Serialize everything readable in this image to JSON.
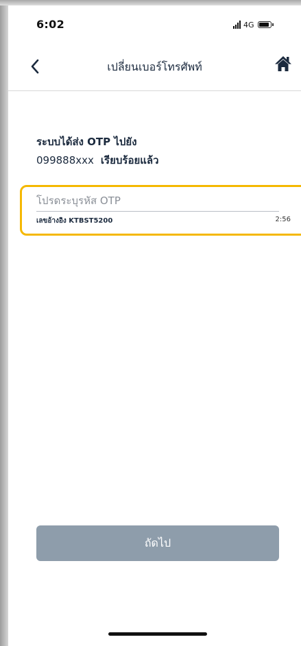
{
  "status_bar": {
    "time": "6:02",
    "network": "4G"
  },
  "header": {
    "title": "เปลี่ยนเบอร์โทรศัพท์"
  },
  "otp": {
    "line1": "ระบบได้ส่ง OTP ไปยัง",
    "phone": "099888xxx",
    "sent_status": "เรียบร้อยแล้ว",
    "placeholder": "โปรดระบุรหัส OTP",
    "value": "",
    "reference": "เลขอ้างอิง KTBST5200",
    "countdown": "2:56"
  },
  "actions": {
    "next_label": "ถัดไป"
  },
  "colors": {
    "highlight": "#f5b800",
    "button": "#8e9dab",
    "text": "#1b2a3e"
  },
  "icons": [
    "back-chevron-icon",
    "home-icon",
    "signal-icon",
    "battery-icon"
  ]
}
